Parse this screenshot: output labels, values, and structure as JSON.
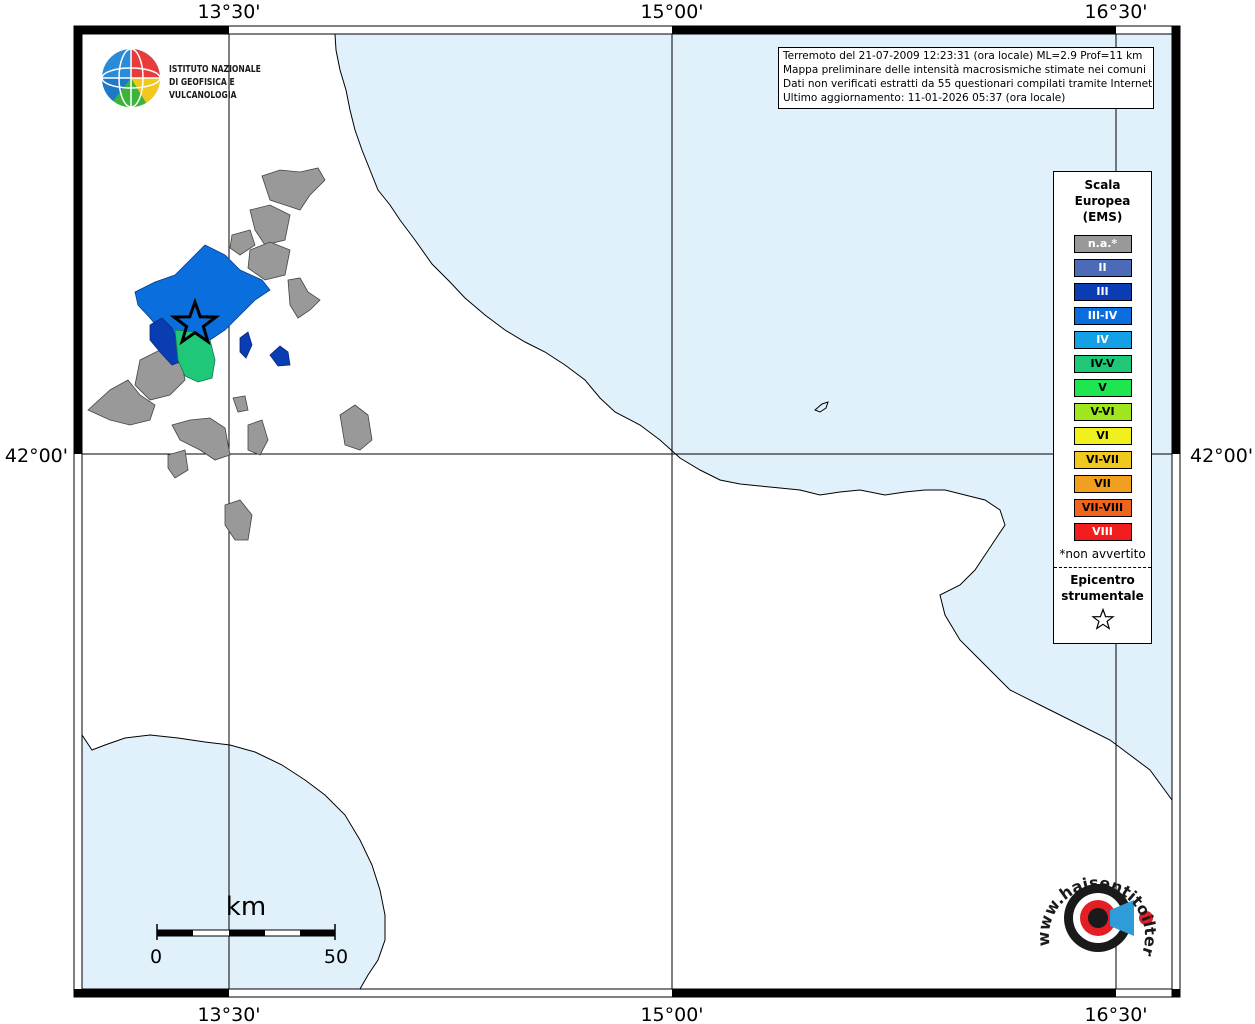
{
  "map": {
    "coord_labels": {
      "top": [
        "13°30'",
        "15°00'",
        "16°30'"
      ],
      "bottom": [
        "13°30'",
        "15°00'",
        "16°30'"
      ],
      "left": [
        "42°00'"
      ],
      "right": [
        "42°00'"
      ]
    },
    "colors": {
      "sea": "#e0f1fc",
      "land": "#ffffff",
      "no_data": "#999999",
      "coast": "#000000"
    }
  },
  "logo": {
    "line1": "ISTITUTO NAZIONALE",
    "line2": "DI GEOFISICA E VULCANOLOGIA"
  },
  "info": {
    "line1": "Terremoto del 21-07-2009 12:23:31 (ora locale) ML=2.9 Prof=11 km",
    "line2": "Mappa preliminare delle intensità macrosismiche stimate nei comuni",
    "line3": "Dati non verificati estratti da 55 questionari compilati tramite Internet.",
    "line4": "Ultimo aggiornamento: 11-01-2026 05:37 (ora locale)"
  },
  "legend": {
    "title_line1": "Scala",
    "title_line2": "Europea",
    "title_line3": "(EMS)",
    "items": [
      {
        "label": "n.a.*",
        "color": "#999999"
      },
      {
        "label": "II",
        "color": "#4c6ab8"
      },
      {
        "label": "III",
        "color": "#0a3cb4"
      },
      {
        "label": "III-IV",
        "color": "#0a6edc"
      },
      {
        "label": "IV",
        "color": "#14a0e6"
      },
      {
        "label": "IV-V",
        "color": "#1ec878"
      },
      {
        "label": "V",
        "color": "#1ee650"
      },
      {
        "label": "V-VI",
        "color": "#a0e61e"
      },
      {
        "label": "VI",
        "color": "#f0f01e"
      },
      {
        "label": "VI-VII",
        "color": "#f0c81e"
      },
      {
        "label": "VII",
        "color": "#f0a01e"
      },
      {
        "label": "VII-VIII",
        "color": "#f0641e"
      },
      {
        "label": "VIII",
        "color": "#f01e1e"
      }
    ],
    "note": "*non avvertito",
    "epicenter_line1": "Epicentro",
    "epicenter_line2": "strumentale"
  },
  "scale_bar": {
    "unit": "km",
    "min_label": "0",
    "max_label": "50"
  },
  "watermark": {
    "text": "www.haisentitoilterremoto.it"
  }
}
